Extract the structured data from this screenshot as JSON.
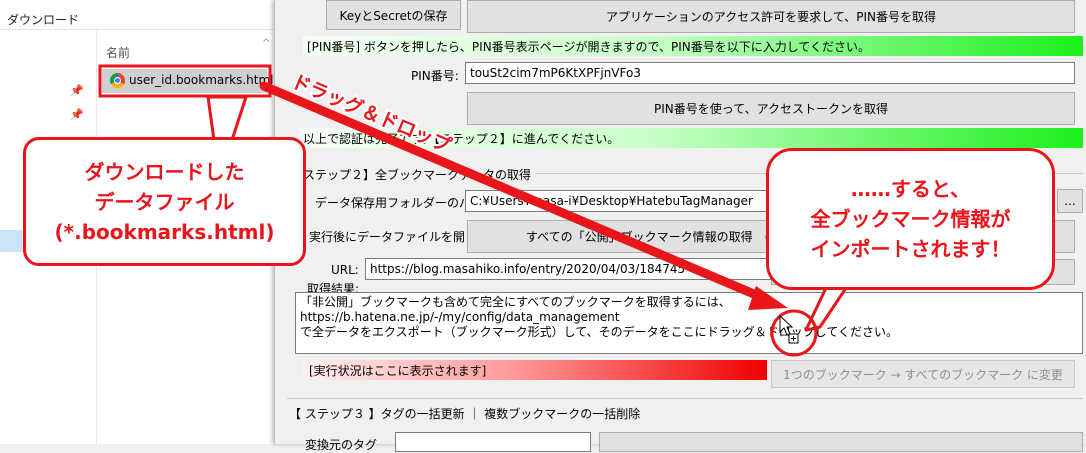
{
  "explorer": {
    "header": "ダウンロード",
    "column_name": "名前",
    "file_name": "user_id.bookmarks.html"
  },
  "app": {
    "save_key_secret_button": "KeyとSecretの保存",
    "request_pin_button": "アプリケーションのアクセス許可を要求して、PIN番号を取得",
    "pin_instruction": "[PIN番号] ボタンを押したら、PIN番号表示ページが開きますので、PIN番号を以下に入力してください。",
    "pin_label": "PIN番号:",
    "pin_value": "touSt2cim7mP6KtXPFjnVFo3",
    "get_token_button": "PIN番号を使って、アクセストークンを取得",
    "auth_done": "以上で認証は完了です。【ステップ２】に進んでください。",
    "step2_title": "ステップ２】全ブックマークデータの取得",
    "folder_label": "データ保存用フォルダーのパス:",
    "folder_value": "C:¥Users¥masa-i¥Desktop¥HatebuTagManager",
    "browse_button": "...",
    "open_after_label": "実行後にデータファイルを開く",
    "open_after_checked": true,
    "get_all_button": "すべての「公開」ブックマーク情報の取得　(※「非公開」ブックマークは取得できません)",
    "url_label": "URL:",
    "url_value": "https://blog.masahiko.info/entry/2020/04/03/184745",
    "result_label": "取得結果:",
    "result_lines": [
      "「非公開」ブックマークも含めて完全にすべてのブックマークを取得するには、",
      "https://b.hatena.ne.jp/-/my/config/data_management",
      "で全データをエクスポート（ブックマーク形式）して、そのデータをここにドラッグ＆ドロップしてください。"
    ],
    "status_text": "[実行状況はここに表示されます]",
    "convert_button": "1つのブックマーク → すべてのブックマーク に変更",
    "step3_title": "【 ステップ３ 】タグの一括更新 ｜ 複数ブックマークの一括削除",
    "step3_label": "変換元のタグ"
  },
  "annotations": {
    "drag_drop": "ドラッグ＆ドロップ",
    "left_callout": [
      "ダウンロードした",
      "データファイル",
      "(*.bookmarks.html)"
    ],
    "right_callout": [
      "……すると、",
      "全ブックマーク情報が",
      "インポートされます！"
    ],
    "accent_color": "#e8151b"
  }
}
